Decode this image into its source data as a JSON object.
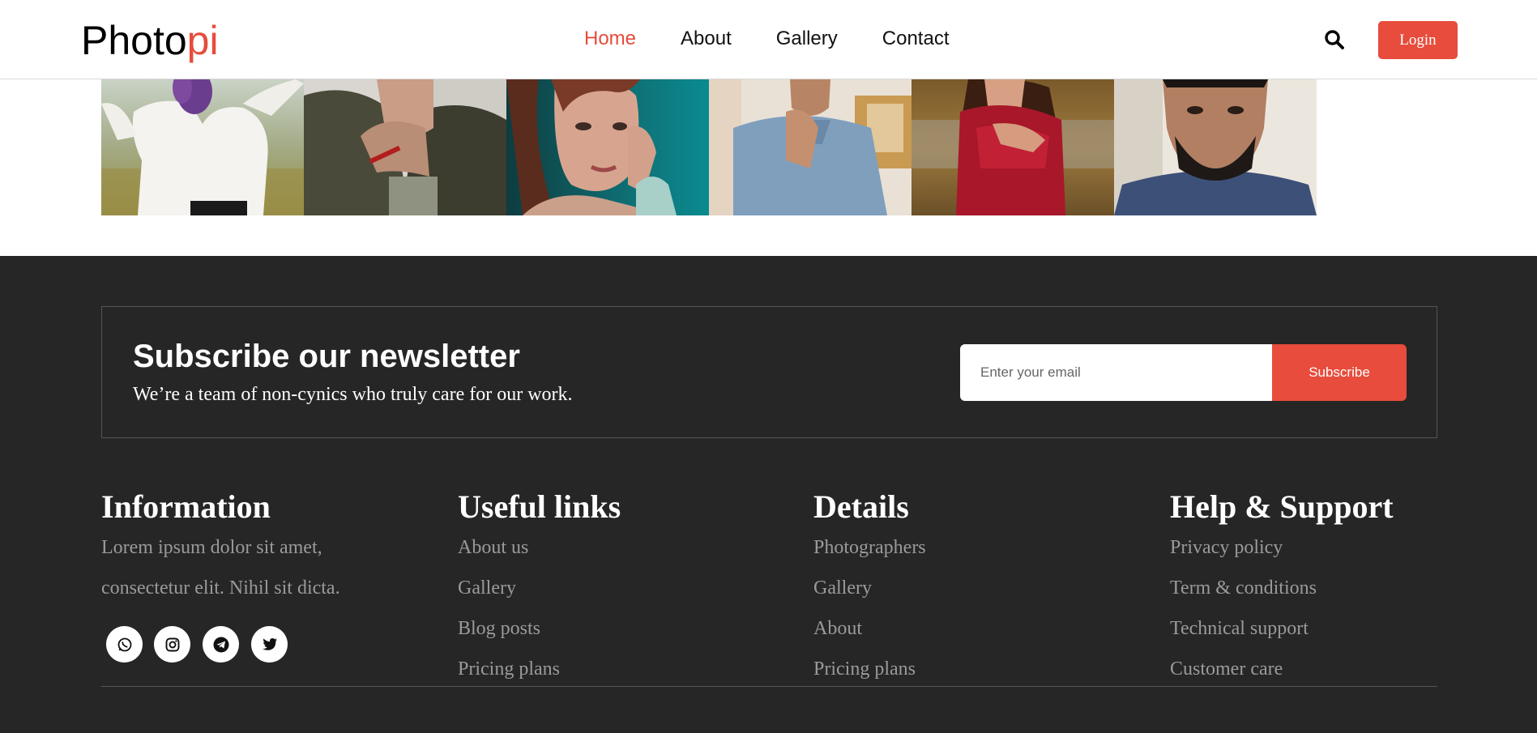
{
  "header": {
    "logo_main": "Photo",
    "logo_accent": "pi",
    "nav": [
      "Home",
      "About",
      "Gallery",
      "Contact"
    ],
    "active_nav": "Home",
    "login_label": "Login",
    "search_icon": "search-icon"
  },
  "colors": {
    "accent": "#e74c3c",
    "footer_bg": "#262626",
    "muted_text": "#9a9a9a"
  },
  "gallery": {
    "photos": [
      "woman-white-shirt-flowers",
      "man-jacket-hand-chin",
      "woman-teal-background",
      "man-blue-polo",
      "woman-red-dress",
      "man-beard-navy-tee"
    ]
  },
  "newsletter": {
    "title": "Subscribe our newsletter",
    "subtitle": "We’re a team of non-cynics who truly care for our work.",
    "email_placeholder": "Enter your email",
    "subscribe_label": "Subscribe"
  },
  "footer": {
    "information": {
      "title": "Information",
      "text": "Lorem ipsum dolor sit amet, consectetur elit. Nihil sit dicta.",
      "socials": [
        "whatsapp-icon",
        "instagram-icon",
        "telegram-icon",
        "twitter-icon"
      ]
    },
    "useful_links": {
      "title": "Useful links",
      "items": [
        "About us",
        "Gallery",
        "Blog posts",
        "Pricing plans"
      ]
    },
    "details": {
      "title": "Details",
      "items": [
        "Photographers",
        "Gallery",
        "About",
        "Pricing plans"
      ]
    },
    "help": {
      "title": "Help & Support",
      "items": [
        "Privacy policy",
        "Term & conditions",
        "Technical support",
        "Customer care"
      ]
    }
  }
}
